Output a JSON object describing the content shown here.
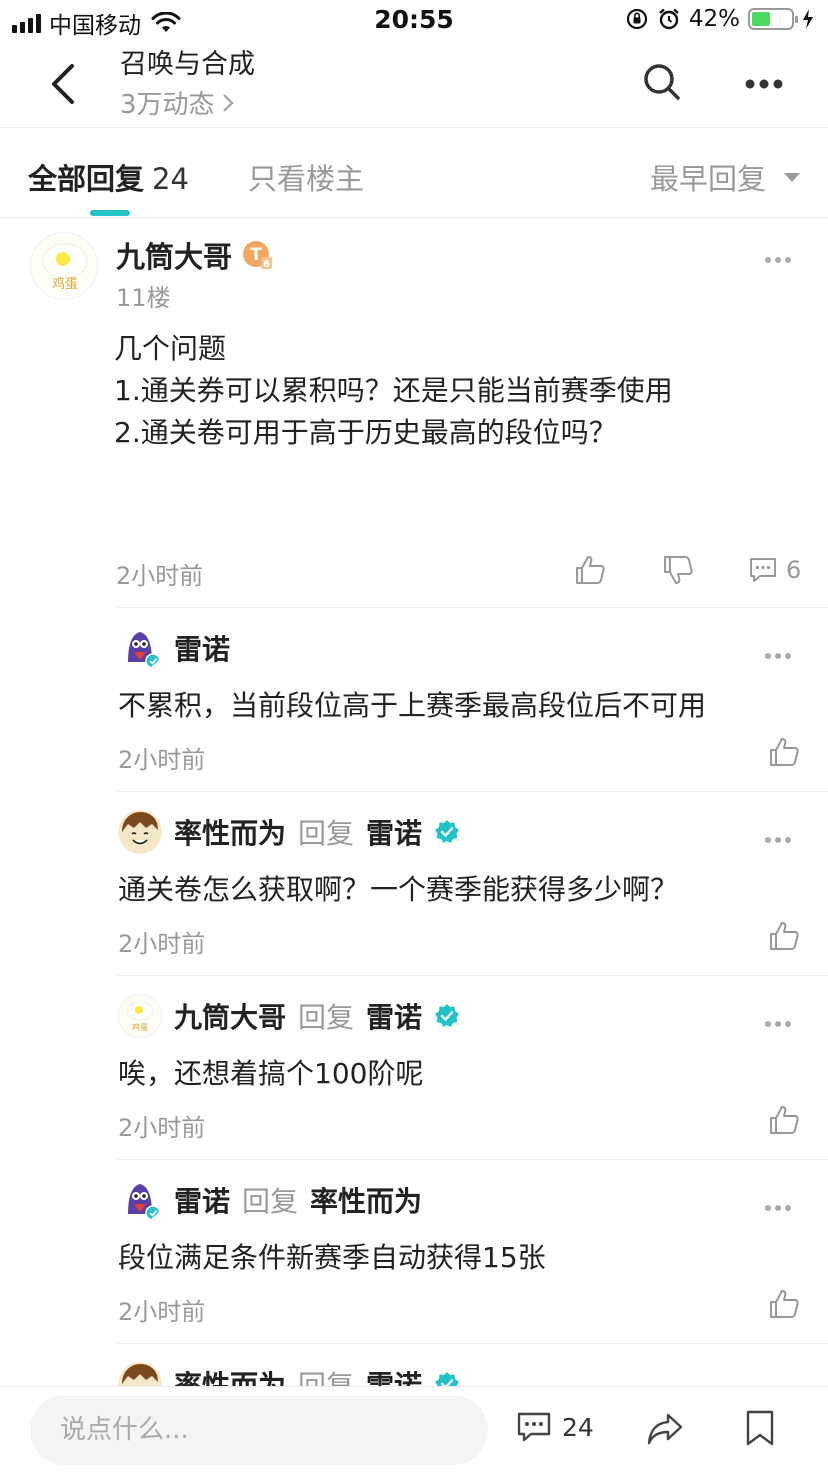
{
  "status_bar": {
    "carrier": "中国移动",
    "time": "20:55",
    "battery": "42%",
    "battery_level": 0.42
  },
  "header": {
    "title": "召唤与合成",
    "subtitle": "3万动态"
  },
  "tabs": {
    "all_label": "全部回复",
    "all_count": "24",
    "op_only": "只看楼主",
    "sort_label": "最早回复"
  },
  "post": {
    "author": "九筒大哥",
    "badge": "T",
    "badge_level": "6",
    "floor": "11楼",
    "body": "几个问题\n1.通关券可以累积吗？还是只能当前赛季使用\n2.通关卷可用于高于历史最高的段位吗？",
    "time": "2小时前",
    "comment_count": "6",
    "avatar_text": "鸡蛋"
  },
  "replies": [
    {
      "author": "雷诺",
      "reply_word": "",
      "target": "",
      "body": "不累积，当前段位高于上赛季最高段位后不可用",
      "time": "2小时前"
    },
    {
      "author": "率性而为",
      "reply_word": "回复",
      "target": "雷诺",
      "body": "通关卷怎么获取啊？一个赛季能获得多少啊？",
      "time": "2小时前"
    },
    {
      "author": "九筒大哥",
      "reply_word": "回复",
      "target": "雷诺",
      "body": "唉，还想着搞个100阶呢",
      "time": "2小时前"
    },
    {
      "author": "雷诺",
      "reply_word": "回复",
      "target": "率性而为",
      "body": "段位满足条件新赛季自动获得15张",
      "time": "2小时前"
    },
    {
      "author": "率性而为",
      "reply_word": "回复",
      "target": "雷诺",
      "body": "",
      "time": ""
    }
  ],
  "bottom_bar": {
    "placeholder": "说点什么...",
    "comment_count": "24"
  },
  "colors": {
    "accent": "#20c3c9",
    "verified": "#20c3c9",
    "muted_text": "#999999",
    "badge_orange": "#f0a860"
  },
  "icons": [
    "back-icon",
    "search-icon",
    "more-icon",
    "thumb-up-icon",
    "thumb-down-icon",
    "comment-icon",
    "share-icon",
    "bookmark-icon",
    "verified-icon"
  ]
}
